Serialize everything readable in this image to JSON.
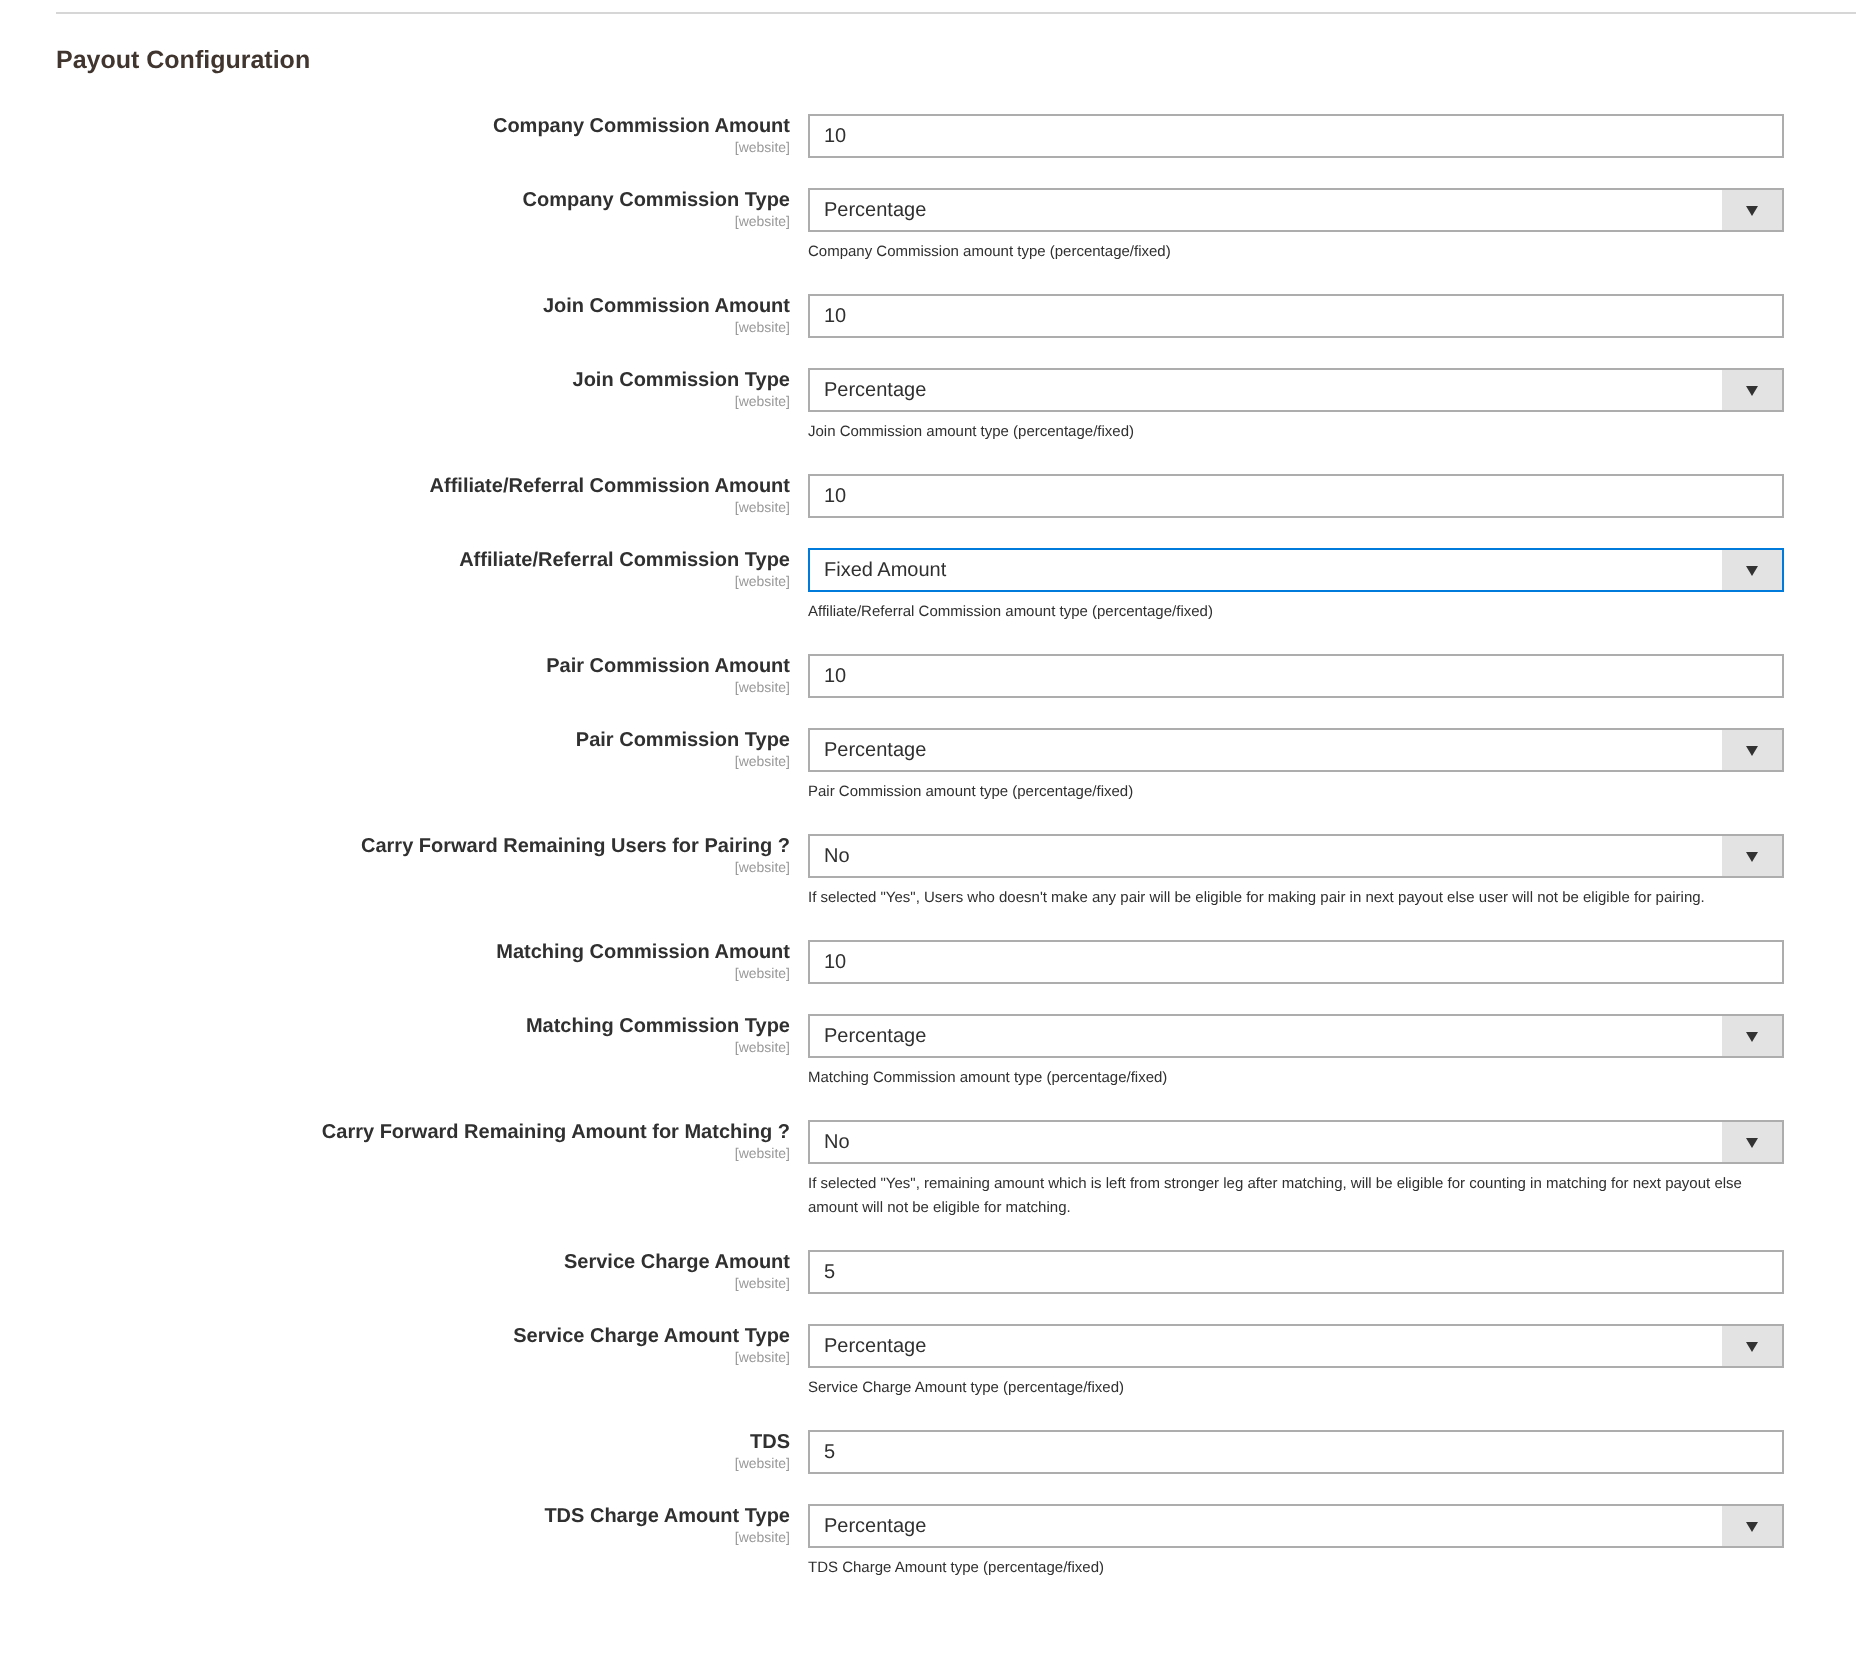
{
  "section": {
    "title": "Payout Configuration"
  },
  "fields": [
    {
      "kind": "text",
      "label": "Company Commission Amount",
      "scope": "[website]",
      "value": "10"
    },
    {
      "kind": "select",
      "label": "Company Commission Type",
      "scope": "[website]",
      "value": "Percentage",
      "focused": false,
      "note": "Company Commission amount type (percentage/fixed)"
    },
    {
      "kind": "text",
      "label": "Join Commission Amount",
      "scope": "[website]",
      "value": "10"
    },
    {
      "kind": "select",
      "label": "Join Commission Type",
      "scope": "[website]",
      "value": "Percentage",
      "focused": false,
      "note": "Join Commission amount type (percentage/fixed)"
    },
    {
      "kind": "text",
      "label": "Affiliate/Referral Commission Amount",
      "scope": "[website]",
      "value": "10"
    },
    {
      "kind": "select",
      "label": "Affiliate/Referral Commission Type",
      "scope": "[website]",
      "value": "Fixed Amount",
      "focused": true,
      "note": "Affiliate/Referral Commission amount type (percentage/fixed)"
    },
    {
      "kind": "text",
      "label": "Pair Commission Amount",
      "scope": "[website]",
      "value": "10"
    },
    {
      "kind": "select",
      "label": "Pair Commission Type",
      "scope": "[website]",
      "value": "Percentage",
      "focused": false,
      "note": "Pair Commission amount type (percentage/fixed)"
    },
    {
      "kind": "select",
      "label": "Carry Forward Remaining Users for Pairing ?",
      "scope": "[website]",
      "value": "No",
      "focused": false,
      "note": "If selected \"Yes\", Users who doesn't make any pair will be eligible for making pair in next payout else user will not be eligible for pairing."
    },
    {
      "kind": "text",
      "label": "Matching Commission Amount",
      "scope": "[website]",
      "value": "10"
    },
    {
      "kind": "select",
      "label": "Matching Commission Type",
      "scope": "[website]",
      "value": "Percentage",
      "focused": false,
      "note": "Matching Commission amount type (percentage/fixed)"
    },
    {
      "kind": "select",
      "label": "Carry Forward Remaining Amount for Matching ?",
      "scope": "[website]",
      "value": "No",
      "focused": false,
      "note": "If selected \"Yes\", remaining amount which is left from stronger leg after matching, will be eligible for counting in matching for next payout else amount will not be eligible for matching."
    },
    {
      "kind": "text",
      "label": "Service Charge Amount",
      "scope": "[website]",
      "value": "5"
    },
    {
      "kind": "select",
      "label": "Service Charge Amount Type",
      "scope": "[website]",
      "value": "Percentage",
      "focused": false,
      "note": "Service Charge Amount type (percentage/fixed)"
    },
    {
      "kind": "text",
      "label": "TDS",
      "scope": "[website]",
      "value": "5"
    },
    {
      "kind": "select",
      "label": "TDS Charge Amount Type",
      "scope": "[website]",
      "value": "Percentage",
      "focused": false,
      "note": "TDS Charge Amount type (percentage/fixed)"
    }
  ]
}
